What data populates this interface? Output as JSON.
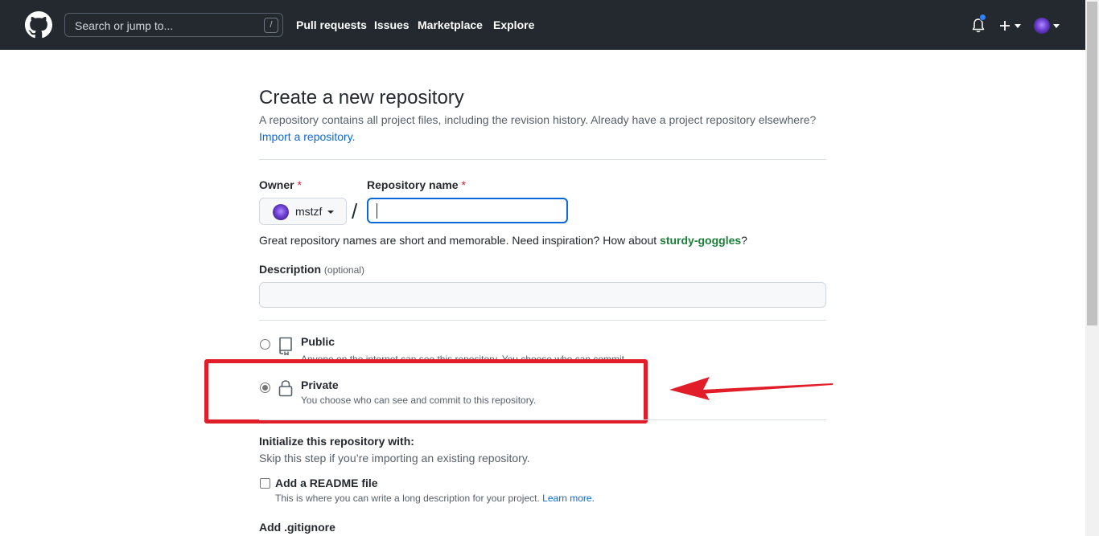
{
  "header": {
    "search_placeholder": "Search or jump to...",
    "search_shortcut": "/",
    "nav": [
      "Pull requests",
      "Issues",
      "Marketplace",
      "Explore"
    ],
    "notification_dot_color": "#2f81f7",
    "bg_color": "#24292f"
  },
  "page": {
    "title": "Create a new repository",
    "subtitle": "A repository contains all project files, including the revision history. Already have a project repository elsewhere?",
    "import_link": "Import a repository."
  },
  "form": {
    "owner_label": "Owner",
    "required_mark": "*",
    "owner_value": "mstzf",
    "separator": "/",
    "repo_label": "Repository name",
    "repo_value": "",
    "hint_prefix": "Great repository names are short and memorable. Need inspiration? How about ",
    "hint_suggestion": "sturdy-goggles",
    "hint_suffix": "?",
    "description_label": "Description",
    "description_optional": "(optional)",
    "description_value": ""
  },
  "visibility": {
    "options": [
      {
        "title": "Public",
        "description": "Anyone on the internet can see this repository. You choose who can commit.",
        "selected": false
      },
      {
        "title": "Private",
        "description": "You choose who can see and commit to this repository.",
        "selected": true
      }
    ],
    "highlight_color": "#e11d2a"
  },
  "init": {
    "heading": "Initialize this repository with:",
    "subheading": "Skip this step if you’re importing an existing repository.",
    "readme_label": "Add a README file",
    "readme_desc": "This is where you can write a long description for your project.",
    "readme_link": "Learn more.",
    "readme_checked": false,
    "gitignore_label": "Add .gitignore"
  }
}
